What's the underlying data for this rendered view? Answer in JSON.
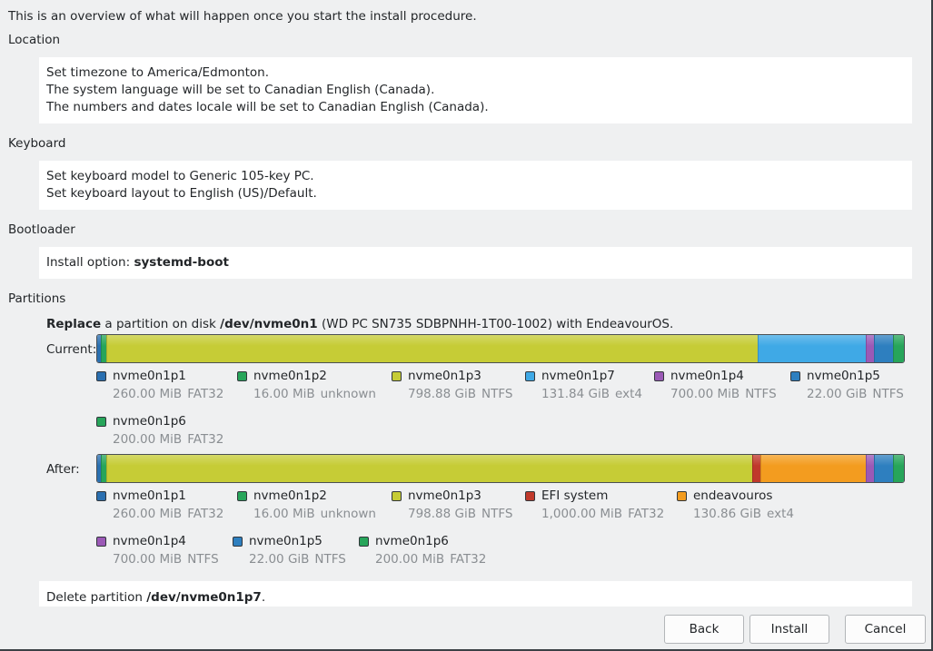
{
  "intro": "This is an overview of what will happen once you start the install procedure.",
  "location": {
    "title": "Location",
    "lines": [
      "Set timezone to America/Edmonton.",
      "The system language will be set to Canadian English (Canada).",
      "The numbers and dates locale will be set to Canadian English (Canada)."
    ]
  },
  "keyboard": {
    "title": "Keyboard",
    "lines": [
      "Set keyboard model to Generic 105-key PC.",
      "Set keyboard layout to English (US)/Default."
    ]
  },
  "bootloader": {
    "title": "Bootloader",
    "prefix": "Install option: ",
    "value": "systemd-boot"
  },
  "partitions": {
    "title": "Partitions",
    "header_bold1": "Replace",
    "header_text1": " a partition on disk ",
    "header_bold2": "/dev/nvme0n1",
    "header_text2": " (WD PC SN735 SDBPNHH-1T00-1002) with EndeavourOS.",
    "current_label": "Current:",
    "after_label": "After:",
    "current": [
      {
        "name": "nvme0n1p1",
        "size": "260.00 MiB",
        "fs": "FAT32",
        "color": "#2a6fb0",
        "share": 0.004
      },
      {
        "name": "nvme0n1p2",
        "size": "16.00 MiB",
        "fs": "unknown",
        "color": "#27a55a",
        "share": 0.006
      },
      {
        "name": "nvme0n1p3",
        "size": "798.88 GiB",
        "fs": "NTFS",
        "color": "#c6cc36",
        "share": 0.812
      },
      {
        "name": "nvme0n1p7",
        "size": "131.84 GiB",
        "fs": "ext4",
        "color": "#3fa9e6",
        "share": 0.134
      },
      {
        "name": "nvme0n1p4",
        "size": "700.00 MiB",
        "fs": "NTFS",
        "color": "#9b59b6",
        "share": 0.009
      },
      {
        "name": "nvme0n1p5",
        "size": "22.00 GiB",
        "fs": "NTFS",
        "color": "#2e7fbf",
        "share": 0.022
      },
      {
        "name": "nvme0n1p6",
        "size": "200.00 MiB",
        "fs": "FAT32",
        "color": "#27a55a",
        "share": 0.013
      }
    ],
    "after": [
      {
        "name": "nvme0n1p1",
        "size": "260.00 MiB",
        "fs": "FAT32",
        "color": "#2a6fb0",
        "share": 0.004
      },
      {
        "name": "nvme0n1p2",
        "size": "16.00 MiB",
        "fs": "unknown",
        "color": "#27a55a",
        "share": 0.006
      },
      {
        "name": "nvme0n1p3",
        "size": "798.88 GiB",
        "fs": "NTFS",
        "color": "#c6cc36",
        "share": 0.806
      },
      {
        "name": "EFI system",
        "size": "1,000.00 MiB",
        "fs": "FAT32",
        "color": "#c0392b",
        "share": 0.009
      },
      {
        "name": "endeavouros",
        "size": "130.86 GiB",
        "fs": "ext4",
        "color": "#f39c1f",
        "share": 0.131
      },
      {
        "name": "nvme0n1p4",
        "size": "700.00 MiB",
        "fs": "NTFS",
        "color": "#9b59b6",
        "share": 0.009
      },
      {
        "name": "nvme0n1p5",
        "size": "22.00 GiB",
        "fs": "NTFS",
        "color": "#2e7fbf",
        "share": 0.022
      },
      {
        "name": "nvme0n1p6",
        "size": "200.00 MiB",
        "fs": "FAT32",
        "color": "#27a55a",
        "share": 0.013
      }
    ],
    "delete_prefix": "Delete partition ",
    "delete_value": "/dev/nvme0n1p7",
    "delete_suffix": "."
  },
  "buttons": {
    "back": "Back",
    "install": "Install",
    "cancel": "Cancel"
  }
}
